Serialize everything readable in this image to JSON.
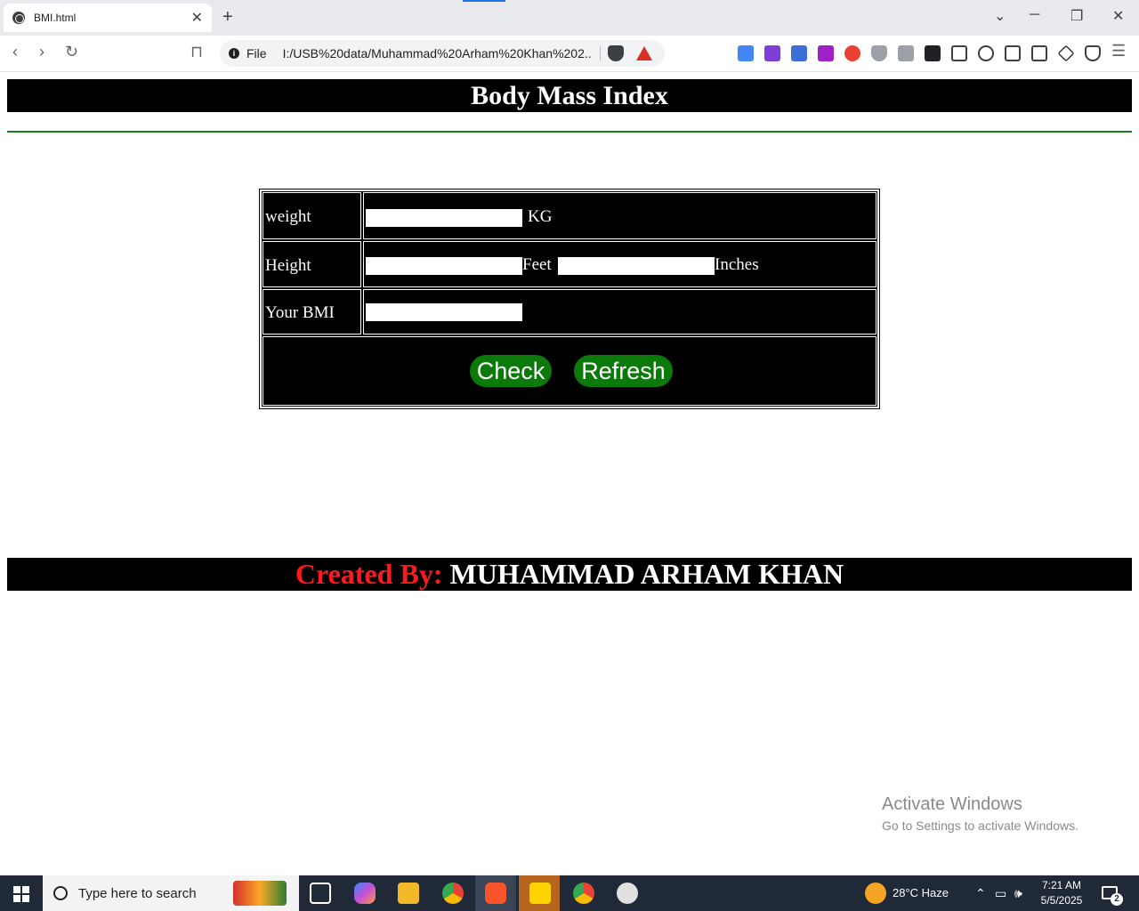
{
  "browser": {
    "tab_title": "BMI.html",
    "tab_close": "✕",
    "new_tab": "+",
    "scheme_label": "File",
    "url": "I:/USB%20data/Muhammad%20Arham%20Khan%202...",
    "win_min": "─",
    "win_restore": "❐",
    "win_close": "✕",
    "chevron": "⌄"
  },
  "page": {
    "heading": "Body Mass Index",
    "rows": {
      "weight_label": "weight",
      "weight_unit": "KG",
      "height_label": "Height",
      "feet_unit": "Feet",
      "inches_unit": "Inches",
      "bmi_label": "Your BMI"
    },
    "buttons": {
      "check": "Check",
      "refresh": "Refresh"
    },
    "footer": {
      "prefix": "Created By:",
      "name": "MUHAMMAD ARHAM KHAN"
    },
    "colors": {
      "footer_prefix": "#ff1a1a",
      "button_bg": "#0b7a0b",
      "hr": "#1a7a1a"
    }
  },
  "watermark": {
    "line1": "Activate Windows",
    "line2": "Go to Settings to activate Windows."
  },
  "taskbar": {
    "search_placeholder": "Type here to search",
    "weather": "28°C  Haze",
    "time": "7:21 AM",
    "date": "5/5/2025",
    "notifications": "2"
  }
}
